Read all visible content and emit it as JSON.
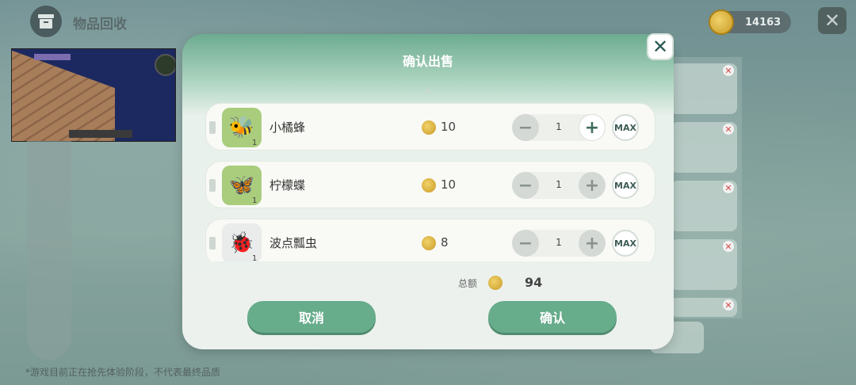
{
  "header": {
    "title": "物品回收"
  },
  "currency": {
    "amount": "14163"
  },
  "dialog": {
    "title": "确认出售",
    "items": [
      {
        "name": "小橘蜂",
        "icon": "bee-icon",
        "emoji": "🐝",
        "count": "1",
        "price": "10",
        "quantity": "1",
        "plus_active": true
      },
      {
        "name": "柠檬蝶",
        "icon": "butterfly-icon",
        "emoji": "🦋",
        "count": "1",
        "price": "10",
        "quantity": "1",
        "plus_active": false
      },
      {
        "name": "波点瓢虫",
        "icon": "ladybug-icon",
        "emoji": "🐞",
        "count": "1",
        "price": "8",
        "quantity": "1",
        "plus_active": false
      }
    ],
    "max_label": "MAX",
    "minus_label": "−",
    "plus_label": "+",
    "total_label": "总额",
    "total_value": "94",
    "cancel_label": "取消",
    "confirm_label": "确认"
  },
  "footnote": "*游戏目前正在抢先体验阶段，不代表最终品质",
  "colors": {
    "accent": "#67ac8b",
    "header_green": "#6cab90",
    "coin": "#e0b43c"
  }
}
